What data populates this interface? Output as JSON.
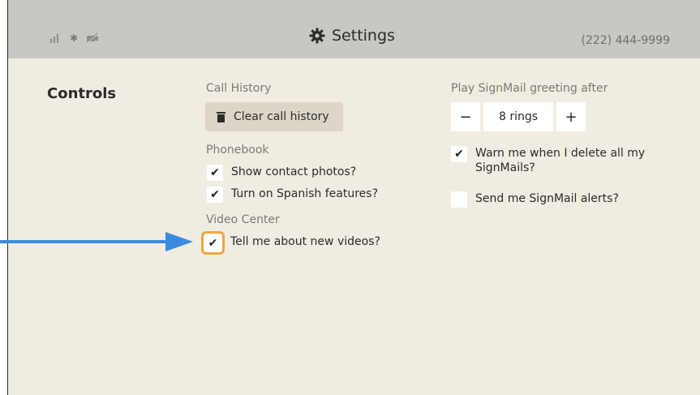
{
  "header": {
    "title": "Settings",
    "phone_number": "(222) 444-9999",
    "status_icons": [
      "signal-icon",
      "bluetooth-icon",
      "camera-off-icon"
    ]
  },
  "section": {
    "title": "Controls"
  },
  "call_history": {
    "label": "Call History",
    "clear_button": "Clear call history"
  },
  "phonebook": {
    "label": "Phonebook",
    "options": [
      {
        "label": "Show contact photos?",
        "checked": true
      },
      {
        "label": "Turn on Spanish features?",
        "checked": true
      }
    ]
  },
  "video_center": {
    "label": "Video Center",
    "options": [
      {
        "label": "Tell me about new videos?",
        "checked": true,
        "focused": true
      }
    ]
  },
  "signmail": {
    "greeting_label": "Play SignMail greeting after",
    "rings_value": "8 rings",
    "minus": "−",
    "plus": "+",
    "options": [
      {
        "label": "Warn me when I delete all my SignMails?",
        "checked": true
      },
      {
        "label": "Send me SignMail alerts?",
        "checked": false
      }
    ]
  },
  "colors": {
    "background": "#f1ece1",
    "topbar": "#c9c7c3",
    "focus_ring": "#f0a643",
    "arrow": "#3a8be0"
  }
}
